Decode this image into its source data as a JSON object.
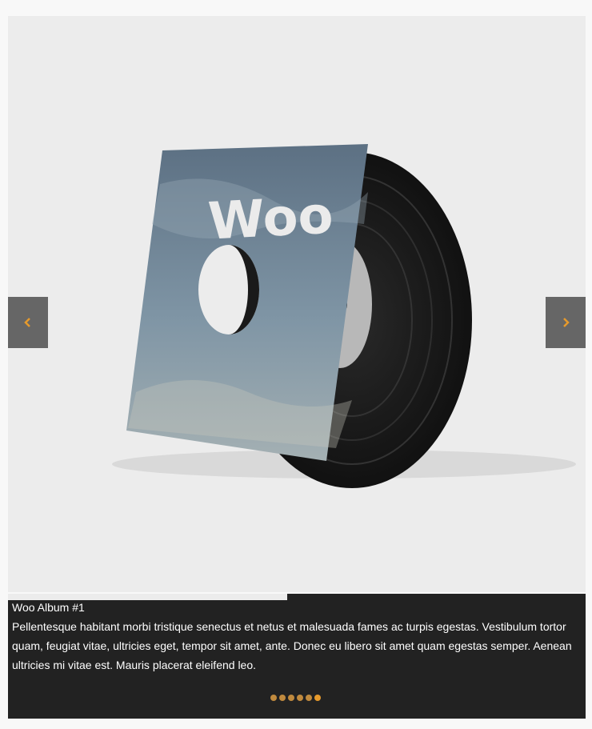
{
  "slide": {
    "album_logo_text": "Woo"
  },
  "caption": {
    "title": "Woo Album #1",
    "text": "Pellentesque habitant morbi tristique senectus et netus et malesuada fames ac turpis egestas. Vestibulum tortor quam, feugiat vitae, ultricies eget, tempor sit amet, ante. Donec eu libero sit amet quam egestas semper. Aenean ultricies mi vitae est. Mauris placerat eleifend leo."
  },
  "navigation": {
    "prev_icon": "chevron-left-icon",
    "next_icon": "chevron-right-icon",
    "pager_count": 6,
    "active_index": 5
  },
  "colors": {
    "accent": "#e69a2c",
    "button_bg": "#666666",
    "caption_bg": "#222222",
    "slide_bg": "#ececec"
  }
}
